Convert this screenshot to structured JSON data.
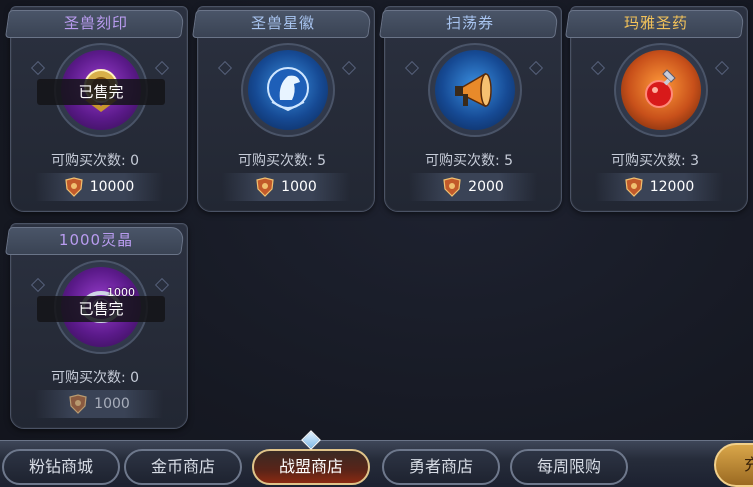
{
  "items": [
    {
      "title": "圣兽刻印",
      "title_color": "purple",
      "icon": "seal-emblem-icon",
      "count_label": "可购买次数: 0",
      "price": "10000",
      "sold_out": "已售完",
      "price_dim": false
    },
    {
      "title": "圣兽星徽",
      "title_color": "blue",
      "icon": "horse-badge-icon",
      "count_label": "可购买次数: 5",
      "price": "1000",
      "sold_out": "",
      "price_dim": false
    },
    {
      "title": "扫荡券",
      "title_color": "blue",
      "icon": "megaphone-icon",
      "count_label": "可购买次数: 5",
      "price": "2000",
      "sold_out": "",
      "price_dim": false
    },
    {
      "title": "玛雅圣药",
      "title_color": "gold",
      "icon": "potion-icon",
      "count_label": "可购买次数: 3",
      "price": "12000",
      "sold_out": "",
      "price_dim": false
    },
    {
      "title": "1000灵晶",
      "title_color": "purple",
      "icon": "crystal-icon",
      "count_label": "可购买次数: 0",
      "price": "1000",
      "sold_out": "已售完",
      "amount": "1000",
      "price_dim": true
    }
  ],
  "tabs": [
    {
      "label": "粉钻商城",
      "active": false
    },
    {
      "label": "金币商店",
      "active": false
    },
    {
      "label": "战盟商店",
      "active": true
    },
    {
      "label": "勇者商店",
      "active": false
    },
    {
      "label": "每周限购",
      "active": false
    }
  ],
  "side_button": {
    "label": "充"
  },
  "colors": {
    "purple_title": "#b99cf0",
    "blue_title": "#a8c4f0",
    "gold_title": "#f2c25a",
    "active_tab_border": "#e0c48a"
  }
}
